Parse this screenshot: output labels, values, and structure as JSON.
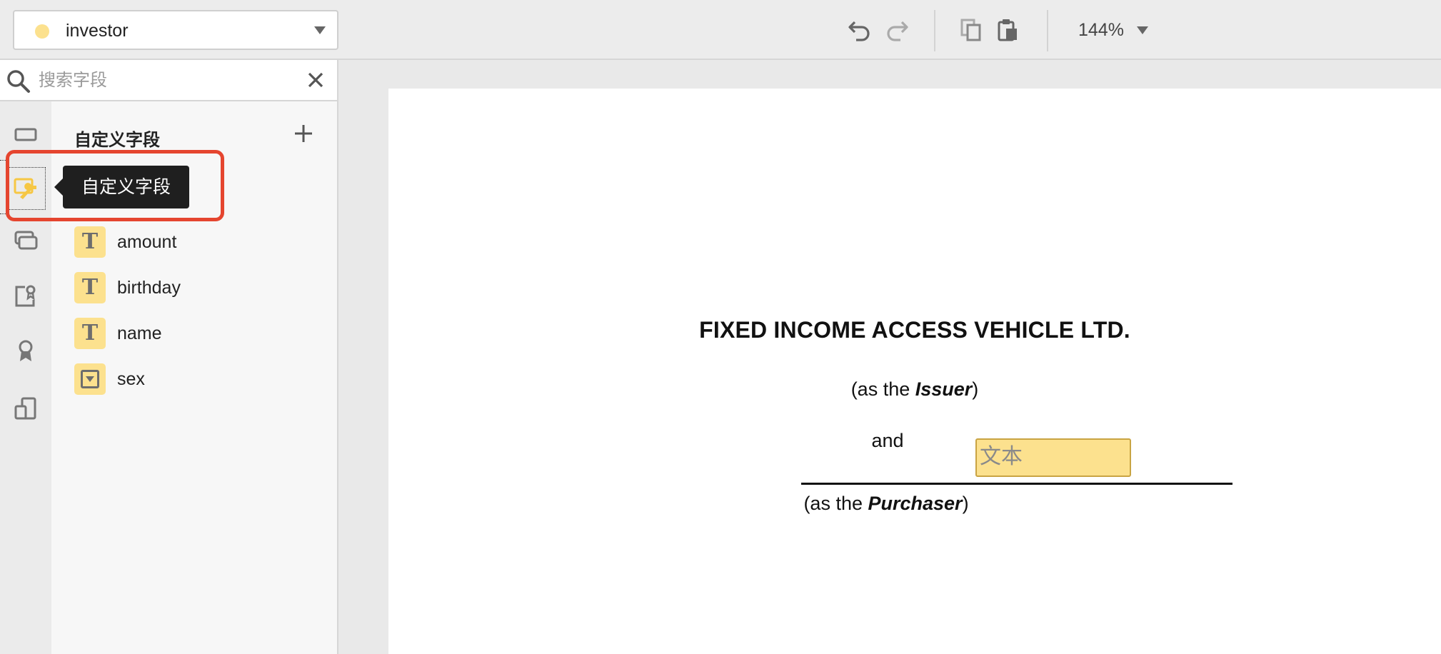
{
  "toolbar": {
    "signer": {
      "name": "investor",
      "dot_color": "#fce18e"
    },
    "zoom": "144%"
  },
  "search": {
    "placeholder": "搜索字段"
  },
  "rail_icons": [
    "text-field-icon",
    "custom-field-icon",
    "multi-field-icon",
    "seal-signature-icon",
    "badge-icon",
    "device-icon"
  ],
  "panel": {
    "title": "自定义字段",
    "tooltip": "自定义字段",
    "fields": [
      {
        "label": "amount",
        "type": "text"
      },
      {
        "label": "birthday",
        "type": "text"
      },
      {
        "label": "name",
        "type": "text"
      },
      {
        "label": "sex",
        "type": "dropdown"
      }
    ]
  },
  "document": {
    "title": "FIXED INCOME ACCESS VEHICLE LTD.",
    "issuer_prefix": "(as the ",
    "issuer_role": "Issuer",
    "issuer_suffix": ")",
    "and": "and",
    "field_placeholder": "文本",
    "purchaser_prefix": "(as the ",
    "purchaser_role": "Purchaser",
    "purchaser_suffix": ")"
  },
  "colors": {
    "highlight": "#e5452f",
    "field_fill": "#fce18e",
    "active_icon": "#f6c744"
  }
}
